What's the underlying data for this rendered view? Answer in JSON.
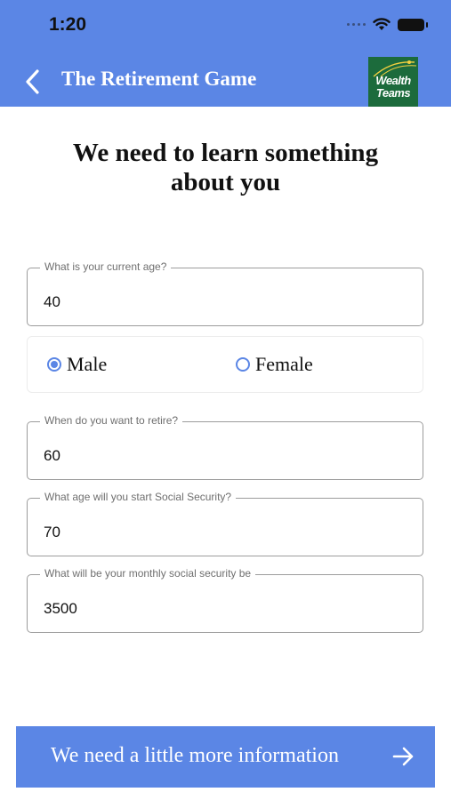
{
  "status_bar": {
    "time": "1:20"
  },
  "nav": {
    "title": "The Retirement Game",
    "logo_text": "Wealth Teams"
  },
  "heading": "We need to learn something about you",
  "fields": [
    {
      "label": "What is your current age?",
      "value": "40"
    },
    {
      "label": "When do you want to retire?",
      "value": "60"
    },
    {
      "label": "What age will you start Social Security?",
      "value": "70"
    },
    {
      "label": "What will be your monthly social security be",
      "value": "3500"
    }
  ],
  "gender": {
    "options": [
      {
        "label": "Male",
        "selected": true
      },
      {
        "label": "Female",
        "selected": false
      }
    ]
  },
  "cta": {
    "label": "We need a little more information"
  },
  "colors": {
    "accent": "#5b86e5",
    "logo_bg": "#1c6b3c"
  }
}
